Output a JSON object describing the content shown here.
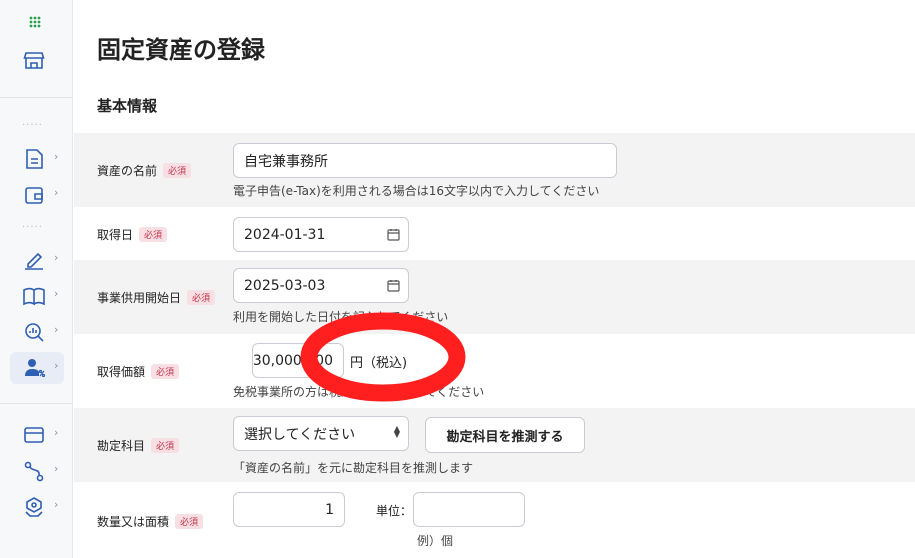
{
  "sidebar": {
    "dots": "·····",
    "chevron": "›",
    "items": [
      {
        "name": "apps-grid-icon"
      },
      {
        "name": "store-icon"
      },
      {
        "name": "document-icon"
      },
      {
        "name": "wallet-icon"
      },
      {
        "name": "pen-signature-icon"
      },
      {
        "name": "book-icon"
      },
      {
        "name": "search-chart-icon"
      },
      {
        "name": "user-percent-icon"
      },
      {
        "name": "card-icon"
      },
      {
        "name": "route-icon"
      },
      {
        "name": "hexagon-hand-icon"
      }
    ]
  },
  "page": {
    "title": "固定資産の登録",
    "section": "基本情報"
  },
  "required_badge": "必須",
  "form": {
    "asset_name": {
      "label": "資産の名前",
      "value": "自宅兼事務所",
      "help": "電子申告(e-Tax)を利用される場合は16文字以内で入力してください"
    },
    "acquired_date": {
      "label": "取得日",
      "value": "2024-01-31"
    },
    "business_start": {
      "label": "事業供用開始日",
      "value": "2025-03-03",
      "help": "利用を開始した日付を記入してください"
    },
    "acquired_price": {
      "label": "取得価額",
      "value": "30,000,000",
      "unit": "円（税込)",
      "help": "免税事業所の方は税込金額を入力してください"
    },
    "account": {
      "label": "勘定科目",
      "value": "選択してください",
      "button": "勘定科目を推測する",
      "help": "「資産の名前」を元に勘定科目を推測します"
    },
    "quantity": {
      "label": "数量又は面積",
      "value": "1",
      "unit_label": "単位：",
      "unit_value": "",
      "unit_example": "例）個"
    }
  },
  "colors": {
    "annotation": "#ff1f1f",
    "badge_text": "#c0324b",
    "badge_bg": "#f8dfe3",
    "active_bg": "#e7ecf6",
    "icon": "#2f5fb3",
    "grid_icon": "#29a14b"
  }
}
